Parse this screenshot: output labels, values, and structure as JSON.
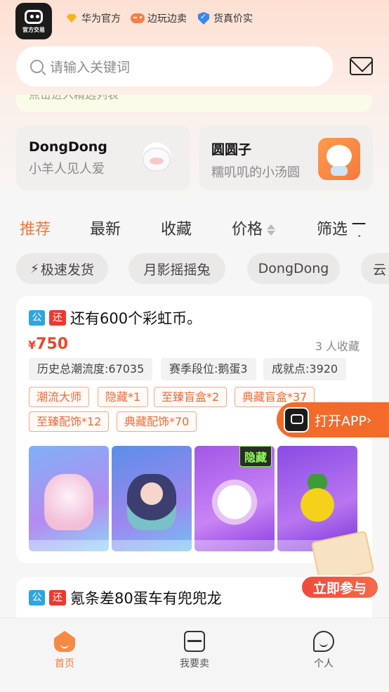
{
  "header": {
    "logo_text": "官方交易",
    "badges": [
      {
        "label": "华为官方",
        "icon": "diamond-icon"
      },
      {
        "label": "边玩边卖",
        "icon": "gamepad-icon"
      },
      {
        "label": "货真价实",
        "icon": "shield-check-icon"
      }
    ],
    "search_placeholder": "请输入关键词"
  },
  "peek_banner": {
    "text": "点击进入精选列表"
  },
  "ip_cards": [
    {
      "title": "DongDong",
      "subtitle": "小羊人见人爱"
    },
    {
      "title": "圆圆子",
      "subtitle": "糯叽叽的小汤圆"
    }
  ],
  "tabs": [
    "推荐",
    "最新",
    "收藏",
    "价格",
    "筛选"
  ],
  "chips": [
    "极速发货",
    "月影摇摇兔",
    "DongDong",
    "云"
  ],
  "listing": {
    "tag_public": "公",
    "tag_return": "还",
    "title": "还有600个彩虹币。",
    "price_symbol": "¥",
    "price": "750",
    "favorites": "3 人收藏",
    "stats": [
      "历史总潮流度:67035",
      "赛季段位:鹅蛋3",
      "成就点:3920"
    ],
    "tags": [
      "潮流大师",
      "隐藏*1",
      "至臻盲盒*2",
      "典藏盲盒*37",
      "至臻配饰*12",
      "典藏配饰*70"
    ],
    "hidden_badge": "隐藏"
  },
  "listing2": {
    "tag_public": "公",
    "tag_return": "还",
    "title": "氪条差80蛋车有兜兜龙"
  },
  "floating": {
    "open_app": "打开APP",
    "join": "立即参与"
  },
  "bottom_nav": [
    {
      "label": "首页"
    },
    {
      "label": "我要卖"
    },
    {
      "label": "个人"
    }
  ],
  "colors": {
    "accent": "#f27a3a",
    "price": "#e54a2e"
  }
}
